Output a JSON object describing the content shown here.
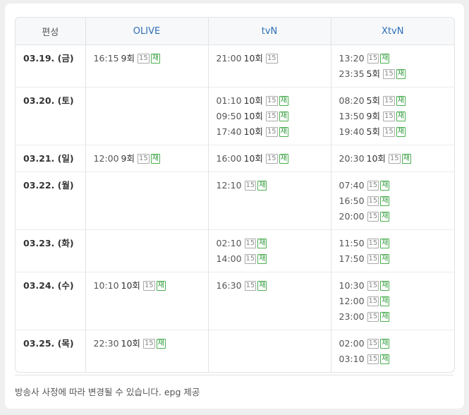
{
  "header": {
    "col0": "편성",
    "ch1": "OLIVE",
    "ch2": "tvN",
    "ch3": "XtvN"
  },
  "badges": {
    "rating": "15",
    "rerun": "재"
  },
  "rows": [
    {
      "date": "03.19. (금)",
      "olive": [
        {
          "time": "16:15",
          "ep": "9회",
          "rerun": true
        }
      ],
      "tvn": [
        {
          "time": "21:00",
          "ep": "10회",
          "rerun": false
        }
      ],
      "xtvn": [
        {
          "time": "13:20",
          "ep": "",
          "rerun": true
        },
        {
          "time": "23:35",
          "ep": "5회",
          "rerun": true
        }
      ]
    },
    {
      "date": "03.20. (토)",
      "olive": [],
      "tvn": [
        {
          "time": "01:10",
          "ep": "10회",
          "rerun": true
        },
        {
          "time": "09:50",
          "ep": "10회",
          "rerun": true
        },
        {
          "time": "17:40",
          "ep": "10회",
          "rerun": true
        }
      ],
      "xtvn": [
        {
          "time": "08:20",
          "ep": "5회",
          "rerun": true
        },
        {
          "time": "13:50",
          "ep": "9회",
          "rerun": true
        },
        {
          "time": "19:40",
          "ep": "5회",
          "rerun": true
        }
      ]
    },
    {
      "date": "03.21. (일)",
      "olive": [
        {
          "time": "12:00",
          "ep": "9회",
          "rerun": true
        }
      ],
      "tvn": [
        {
          "time": "16:00",
          "ep": "10회",
          "rerun": true
        }
      ],
      "xtvn": [
        {
          "time": "20:30",
          "ep": "10회",
          "rerun": true
        }
      ]
    },
    {
      "date": "03.22. (월)",
      "olive": [],
      "tvn": [
        {
          "time": "12:10",
          "ep": "",
          "rerun": true
        }
      ],
      "xtvn": [
        {
          "time": "07:40",
          "ep": "",
          "rerun": true
        },
        {
          "time": "16:50",
          "ep": "",
          "rerun": true
        },
        {
          "time": "20:00",
          "ep": "",
          "rerun": true
        }
      ]
    },
    {
      "date": "03.23. (화)",
      "olive": [],
      "tvn": [
        {
          "time": "02:10",
          "ep": "",
          "rerun": true
        },
        {
          "time": "14:00",
          "ep": "",
          "rerun": true
        }
      ],
      "xtvn": [
        {
          "time": "11:50",
          "ep": "",
          "rerun": true
        },
        {
          "time": "17:50",
          "ep": "",
          "rerun": true
        }
      ]
    },
    {
      "date": "03.24. (수)",
      "olive": [
        {
          "time": "10:10",
          "ep": "10회",
          "rerun": true
        }
      ],
      "tvn": [
        {
          "time": "16:30",
          "ep": "",
          "rerun": true
        }
      ],
      "xtvn": [
        {
          "time": "10:30",
          "ep": "",
          "rerun": true
        },
        {
          "time": "12:00",
          "ep": "",
          "rerun": true
        },
        {
          "time": "23:00",
          "ep": "",
          "rerun": true
        }
      ]
    },
    {
      "date": "03.25. (목)",
      "olive": [
        {
          "time": "22:30",
          "ep": "10회",
          "rerun": true
        }
      ],
      "tvn": [],
      "xtvn": [
        {
          "time": "02:00",
          "ep": "",
          "rerun": true
        },
        {
          "time": "03:10",
          "ep": "",
          "rerun": true
        }
      ]
    }
  ],
  "footer": {
    "note": "방송사 사정에 따라 변경될 수 있습니다. epg 제공"
  },
  "colors": {
    "channel_header": "#2d6fb6",
    "rerun_badge": "#2e9a3a"
  }
}
